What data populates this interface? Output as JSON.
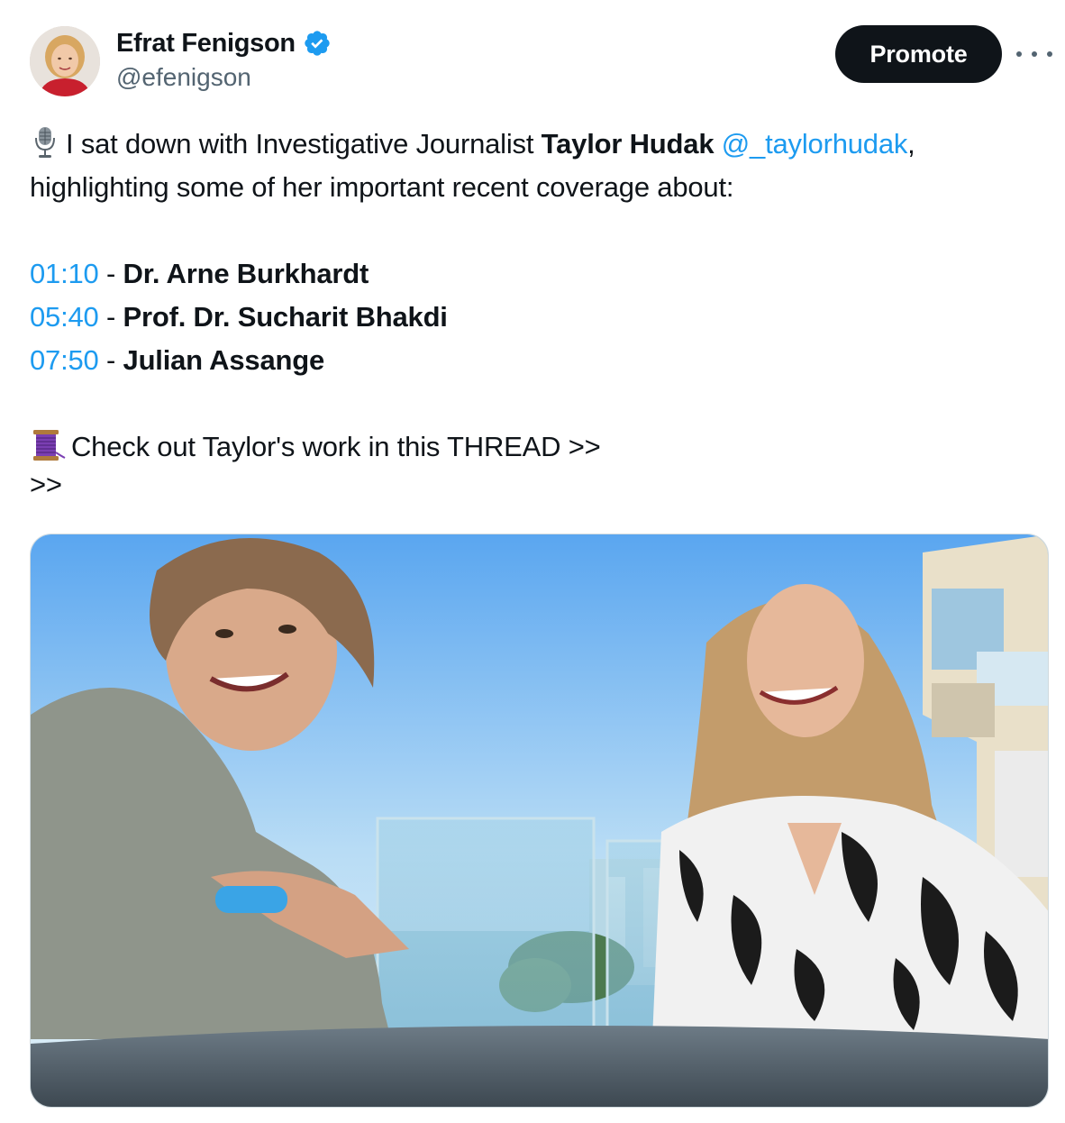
{
  "author": {
    "display_name": "Efrat Fenigson",
    "handle": "@efenigson",
    "verified": true,
    "avatar_icon": "profile-photo"
  },
  "actions": {
    "promote_label": "Promote",
    "more_icon": "more-horizontal-icon"
  },
  "tweet": {
    "emoji_microphone": "studio-microphone-icon",
    "intro_text": "I sat down with Investigative Journalist ",
    "guest_name": "Taylor Hudak",
    "guest_space": " ",
    "guest_handle": "@_taylorhudak",
    "intro_comma": ",",
    "line2": "highlighting some of her important recent coverage about:",
    "chapters": [
      {
        "time": "01:10",
        "sep": " - ",
        "title": "Dr. Arne Burkhardt"
      },
      {
        "time": "05:40",
        "sep": " - ",
        "title": "Prof. Dr. Sucharit Bhakdi"
      },
      {
        "time": "07:50",
        "sep": " - ",
        "title": "Julian Assange"
      }
    ],
    "emoji_thread": "spool-of-thread-icon",
    "thread_text": "Check out Taylor's work in this THREAD >>",
    "thread_tail": ">>"
  },
  "media": {
    "type": "video",
    "icon": "video-thumbnail"
  },
  "colors": {
    "link": "#1d9bf0",
    "verified": "#1d9bf0",
    "text": "#0f1419",
    "secondary": "#536471",
    "promote_bg": "#0f1419"
  }
}
